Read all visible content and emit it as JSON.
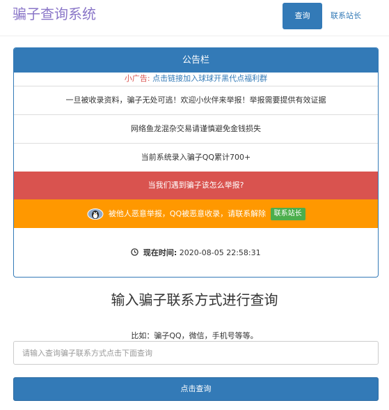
{
  "header": {
    "brand": "骗子查询系统",
    "nav_query": "查询",
    "nav_contact": "联系站长"
  },
  "notice": {
    "title": "公告栏",
    "ad_label": "小广告:",
    "ad_link": "点击链接加入球球开黑代点福利群",
    "line1": "一旦被收录资料，骗子无处可逃！欢迎小伙伴来举报！举报需要提供有效证据",
    "line2": "网络鱼龙混杂交易请谨慎避免金钱损失",
    "line3": "当前系统录入骗子QQ累计700+",
    "report_link": "当我们遇到骗子该怎么举报?",
    "appeal_text": "被他人恶意举报，QQ被恶意收录，请联系解除",
    "appeal_badge": "联系站长",
    "time_label": "现在时间:",
    "time_value": "2020-08-05 22:58:31"
  },
  "query": {
    "title": "输入骗子联系方式进行查询",
    "hint": "比如：骗子QQ，微信，手机号等等。",
    "placeholder": "请输入查询骗子联系方式点击下面查询",
    "submit": "点击查询"
  },
  "colors": {
    "primary": "#337ab7",
    "brand": "#8a76c8",
    "danger": "#d9534f",
    "warning": "#ff9800",
    "success": "#4cae4c"
  }
}
